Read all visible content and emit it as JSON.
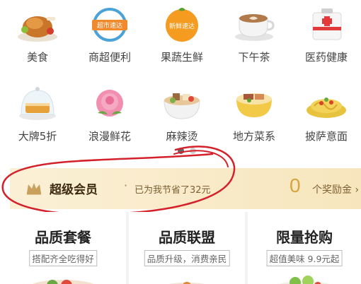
{
  "categories_row1": [
    {
      "label": "美食",
      "icon": "roast-chicken-icon"
    },
    {
      "label": "商超便利",
      "icon": "supermarket-express-icon",
      "badge": "超市速达"
    },
    {
      "label": "果蔬生鲜",
      "icon": "fresh-express-icon",
      "badge": "新鲜速达"
    },
    {
      "label": "下午茶",
      "icon": "coffee-cup-icon"
    },
    {
      "label": "医药健康",
      "icon": "medicine-box-icon"
    }
  ],
  "categories_row2": [
    {
      "label": "大牌5折",
      "icon": "cake-dome-icon"
    },
    {
      "label": "浪漫鲜花",
      "icon": "rose-icon"
    },
    {
      "label": "麻辣烫",
      "icon": "spicy-hotpot-icon"
    },
    {
      "label": "地方菜系",
      "icon": "regional-dish-icon"
    },
    {
      "label": "披萨意面",
      "icon": "pasta-icon"
    }
  ],
  "member": {
    "title": "超级会员",
    "separator": "·",
    "saved_text": "已为我节省了32元",
    "reward_count": "0",
    "reward_label": "个奖励金 ›"
  },
  "cards": [
    {
      "title": "品质套餐",
      "subtitle": "搭配齐全吃得好"
    },
    {
      "title": "品质联盟",
      "subtitle": "品质升级，消费亲民"
    },
    {
      "title": "限量抢购",
      "subtitle": "超值美味 9.9元起"
    }
  ],
  "colors": {
    "member_bg": "#f9ecca",
    "reward_count": "#d7a53c",
    "annotation_circle": "#d4202a"
  }
}
